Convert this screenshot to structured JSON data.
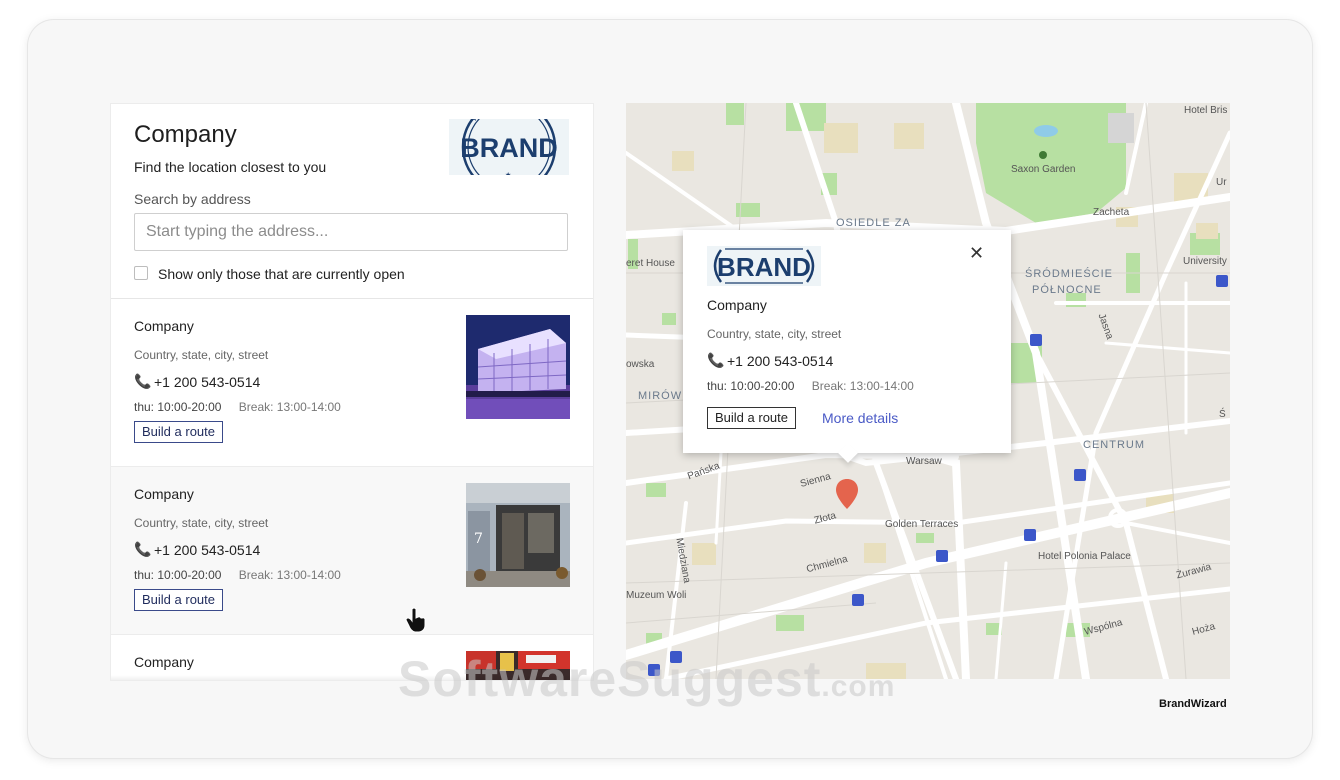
{
  "panel": {
    "title": "Company",
    "subtitle": "Find the location closest to you",
    "brand_logo_text": "BRAND",
    "search_label": "Search by address",
    "search_placeholder": "Start typing the address...",
    "search_value": "",
    "open_filter_label": "Show only those that are currently open",
    "open_filter_checked": false
  },
  "locations": [
    {
      "name": "Company",
      "address": "Country, state, city, street",
      "phone": "+1 200 543-0514",
      "day": "thu:",
      "hours": "10:00-20:00",
      "break_label": "Break:",
      "break_hours": "13:00-14:00",
      "route_label": "Build a route"
    },
    {
      "name": "Company",
      "address": "Country, state, city, street",
      "phone": "+1 200 543-0514",
      "day": "thu:",
      "hours": "10:00-20:00",
      "break_label": "Break:",
      "break_hours": "13:00-14:00",
      "route_label": "Build a route"
    },
    {
      "name": "Company"
    }
  ],
  "popup": {
    "brand_logo_text": "BRAND",
    "close_glyph": "✕",
    "name": "Company",
    "address": "Country, state, city, street",
    "phone": "+1 200 543-0514",
    "day": "thu:",
    "hours": "10:00-20:00",
    "break_label": "Break:",
    "break_hours": "13:00-14:00",
    "route_label": "Build a route",
    "more_label": "More details"
  },
  "map": {
    "labels": {
      "hotel_bris": "Hotel Bris",
      "saxon_garden": "Saxon Garden",
      "zacheta": "Zacheta",
      "osiedle": "OSIEDLE ZA",
      "eret_house": "eret House",
      "srodmiescie1": "ŚRÓDMIEŚCIE",
      "srodmiescie2": "PÓŁNOCNE",
      "university": "University",
      "jasna": "Jasna",
      "owska": "owska",
      "mirow": "MIRÓW",
      "centrum": "CENTRUM",
      "panska": "Pańska",
      "sienna": "Sienna",
      "warsaw": "Warsaw",
      "zlota": "Złota",
      "golden_terraces": "Golden Terraces",
      "miedziana": "Miedziana",
      "chmielna": "Chmielna",
      "hotel_polonia": "Hotel Polonia Palace",
      "zurawia": "Żurawia",
      "muzeum_woli": "Muzeum Woli",
      "wspolna": "Wspólna",
      "hoza": "Hoża",
      "s_edge": "Ś",
      "ur_edge": "Ur"
    },
    "marker_color": "#e4644d",
    "park_color": "#b7e0a2",
    "water_color": "#8fcbe8"
  },
  "watermark": {
    "main": "SoftwareSuggest",
    "suffix": ".com"
  },
  "footer_brand": "BrandWizard",
  "colors": {
    "link": "#4a5ac6",
    "route_border": "#3a4a8a",
    "brand_navy": "#1c3e6e"
  }
}
